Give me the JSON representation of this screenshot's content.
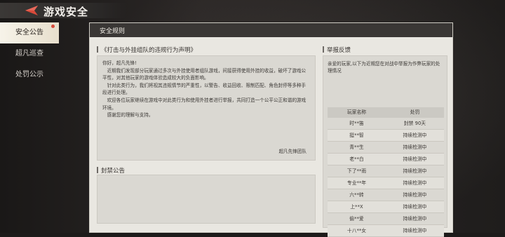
{
  "header": {
    "title": "游戏安全"
  },
  "sidebar": {
    "items": [
      {
        "label": "安全公告"
      },
      {
        "label": "超凡巡查"
      },
      {
        "label": "处罚公示"
      }
    ]
  },
  "panel": {
    "title": "安全规则",
    "notice": {
      "title": "《打击与外挂组队的违规行为声明》",
      "lines": [
        "你好，超凡先锋!",
        "　近期我们发现部分玩家通过多次与外挂使用者组队游戏，间接获得使用外挂的收益，破坏了游戏公平性，对其他玩家的游戏体验造成较大的负面影响。",
        "　针对此类行为，我们将视其违规情节的严重性，以警告、收益回收、限制匹配、角色封停等多种手段进行处理。",
        "　欢迎各位玩家继续在游戏中对此类行为和使用外挂者进行举报，共同打造一个公平公正和谐的游戏环境。",
        "　感谢您的理解与支持。"
      ],
      "signature": "超凡先锋团队"
    },
    "ban": {
      "title": "封禁公告"
    },
    "report": {
      "title": "举报反馈",
      "description": "亲爱的玩家,以下为近期您在对战中举报为作弊玩家的处理情况",
      "columns": [
        "玩家名称",
        "处罚"
      ],
      "rows": [
        {
          "name": "时**笛",
          "penalty": "封禁 90天"
        },
        {
          "name": "挺**智",
          "penalty": "持续检测中"
        },
        {
          "name": "青**生",
          "penalty": "持续检测中"
        },
        {
          "name": "老**白",
          "penalty": "持续检测中"
        },
        {
          "name": "下了**雨",
          "penalty": "持续检测中"
        },
        {
          "name": "专业**年",
          "penalty": "持续检测中"
        },
        {
          "name": "六**转",
          "penalty": "持续检测中"
        },
        {
          "name": "上**X",
          "penalty": "持续检测中"
        },
        {
          "name": "偷**爱",
          "penalty": "持续检测中"
        },
        {
          "name": "十八**女",
          "penalty": "持续检测中"
        }
      ]
    }
  },
  "colors": {
    "accent": "#d84a3a",
    "panel_bg": "#e9e7e1",
    "header_bg": "#3a3735"
  }
}
